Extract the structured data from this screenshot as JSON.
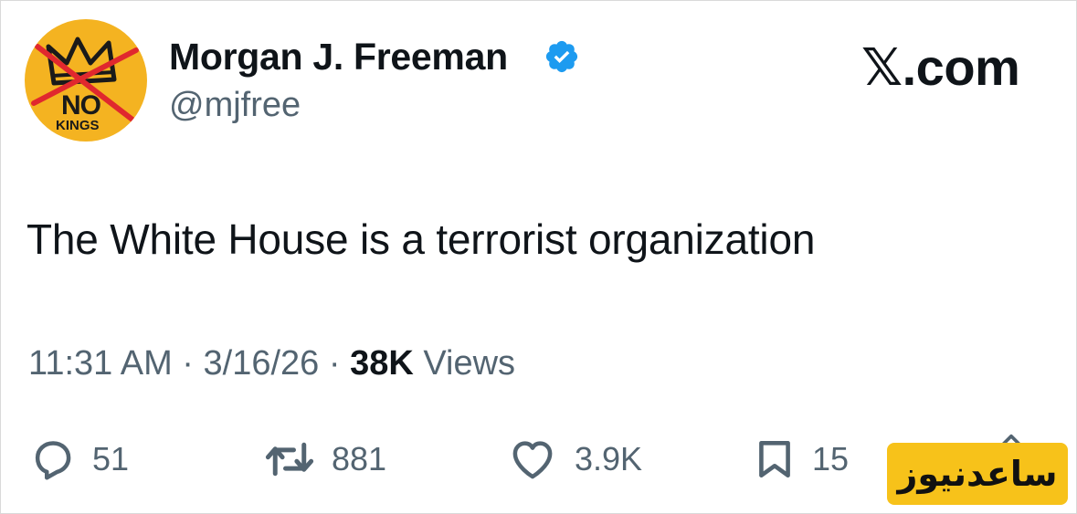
{
  "author": {
    "display_name": "Morgan J. Freeman",
    "handle": "@mjfree",
    "verified": true,
    "avatar": {
      "text_top": "NO",
      "text_bottom": "KINGS",
      "background_color": "#f4b321",
      "icon": "crossed-out-crown"
    }
  },
  "brand": "𝕏.com",
  "tweet": {
    "text": "The White House is a terrorist organization"
  },
  "meta": {
    "time": "11:31 AM",
    "separator": " · ",
    "date": "3/16/26",
    "views_count": "38K",
    "views_label": " Views"
  },
  "actions": {
    "replies": "51",
    "reposts": "881",
    "likes": "3.9K",
    "bookmarks": "15"
  },
  "watermark": {
    "text": "ساعدنیوز",
    "color": "#f7c21a"
  },
  "colors": {
    "verified_blue": "#1d9bf0",
    "muted_text": "#536471",
    "primary_text": "#0f1419",
    "strike_red": "#e0282e"
  }
}
